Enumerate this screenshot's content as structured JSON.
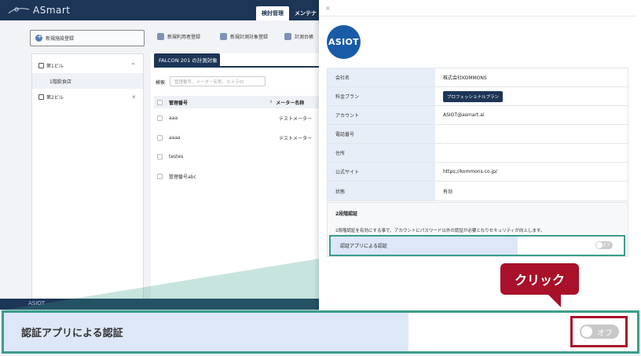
{
  "app": {
    "logo_text": "ASmart",
    "top_tabs": [
      "検討管理",
      "メンテナ"
    ],
    "toolbar": {
      "new_facility": "新規施設登録",
      "new_user": "新規利用者登録",
      "new_plan": "新規計測対象登録",
      "ledger": "計測台帳"
    },
    "tree": [
      {
        "label": "第1ビル",
        "chevron": "^"
      },
      {
        "label": "1階飲食店"
      },
      {
        "label": "第2ビル",
        "chevron": "v"
      }
    ],
    "mid": {
      "tab": "FALCON 201 の計測対象",
      "search_label": "検索",
      "search_placeholder": "管理番号、メーター名称、カメラID",
      "col_id": "管理番号",
      "col_meter": "メーター名称",
      "rows": [
        {
          "id": "aaa",
          "meter": "テストメーター"
        },
        {
          "id": "aaaa",
          "meter": "テストメーター"
        },
        {
          "id": "testes",
          "meter": ""
        },
        {
          "id": "管理番号abc",
          "meter": ""
        }
      ]
    },
    "footer_text": "ASIOT"
  },
  "drawer": {
    "close": "×",
    "logo_text": "ASIOT",
    "info": [
      {
        "key": "会社名",
        "value": "株式会社KOMMONS"
      },
      {
        "key": "料金プラン",
        "value": "プロフェッショナルプラン",
        "badge": true
      },
      {
        "key": "アカウント",
        "value": "ASIOT@asmart.ai"
      },
      {
        "key": "電話番号",
        "value": ""
      },
      {
        "key": "住所",
        "value": ""
      },
      {
        "key": "公式サイト",
        "value": "https://kommons.co.jp/"
      },
      {
        "key": "状態",
        "value": "有効"
      }
    ],
    "twofa": {
      "title": "2段階認証",
      "description": "2段階認証を有効にする事で、アカウントにパスワード以外の認証が必要となりセキュリティが向上します。",
      "row_label": "認証アプリによる認証",
      "toggle_text": "オフ"
    }
  },
  "callout": {
    "label": "クリック"
  },
  "zoom": {
    "row_label": "認証アプリによる認証",
    "toggle_text": "オフ"
  },
  "colors": {
    "navy": "#1d3557",
    "teal": "#3a9e8a",
    "red": "#a9102a",
    "key_bg": "#dde7f7"
  }
}
